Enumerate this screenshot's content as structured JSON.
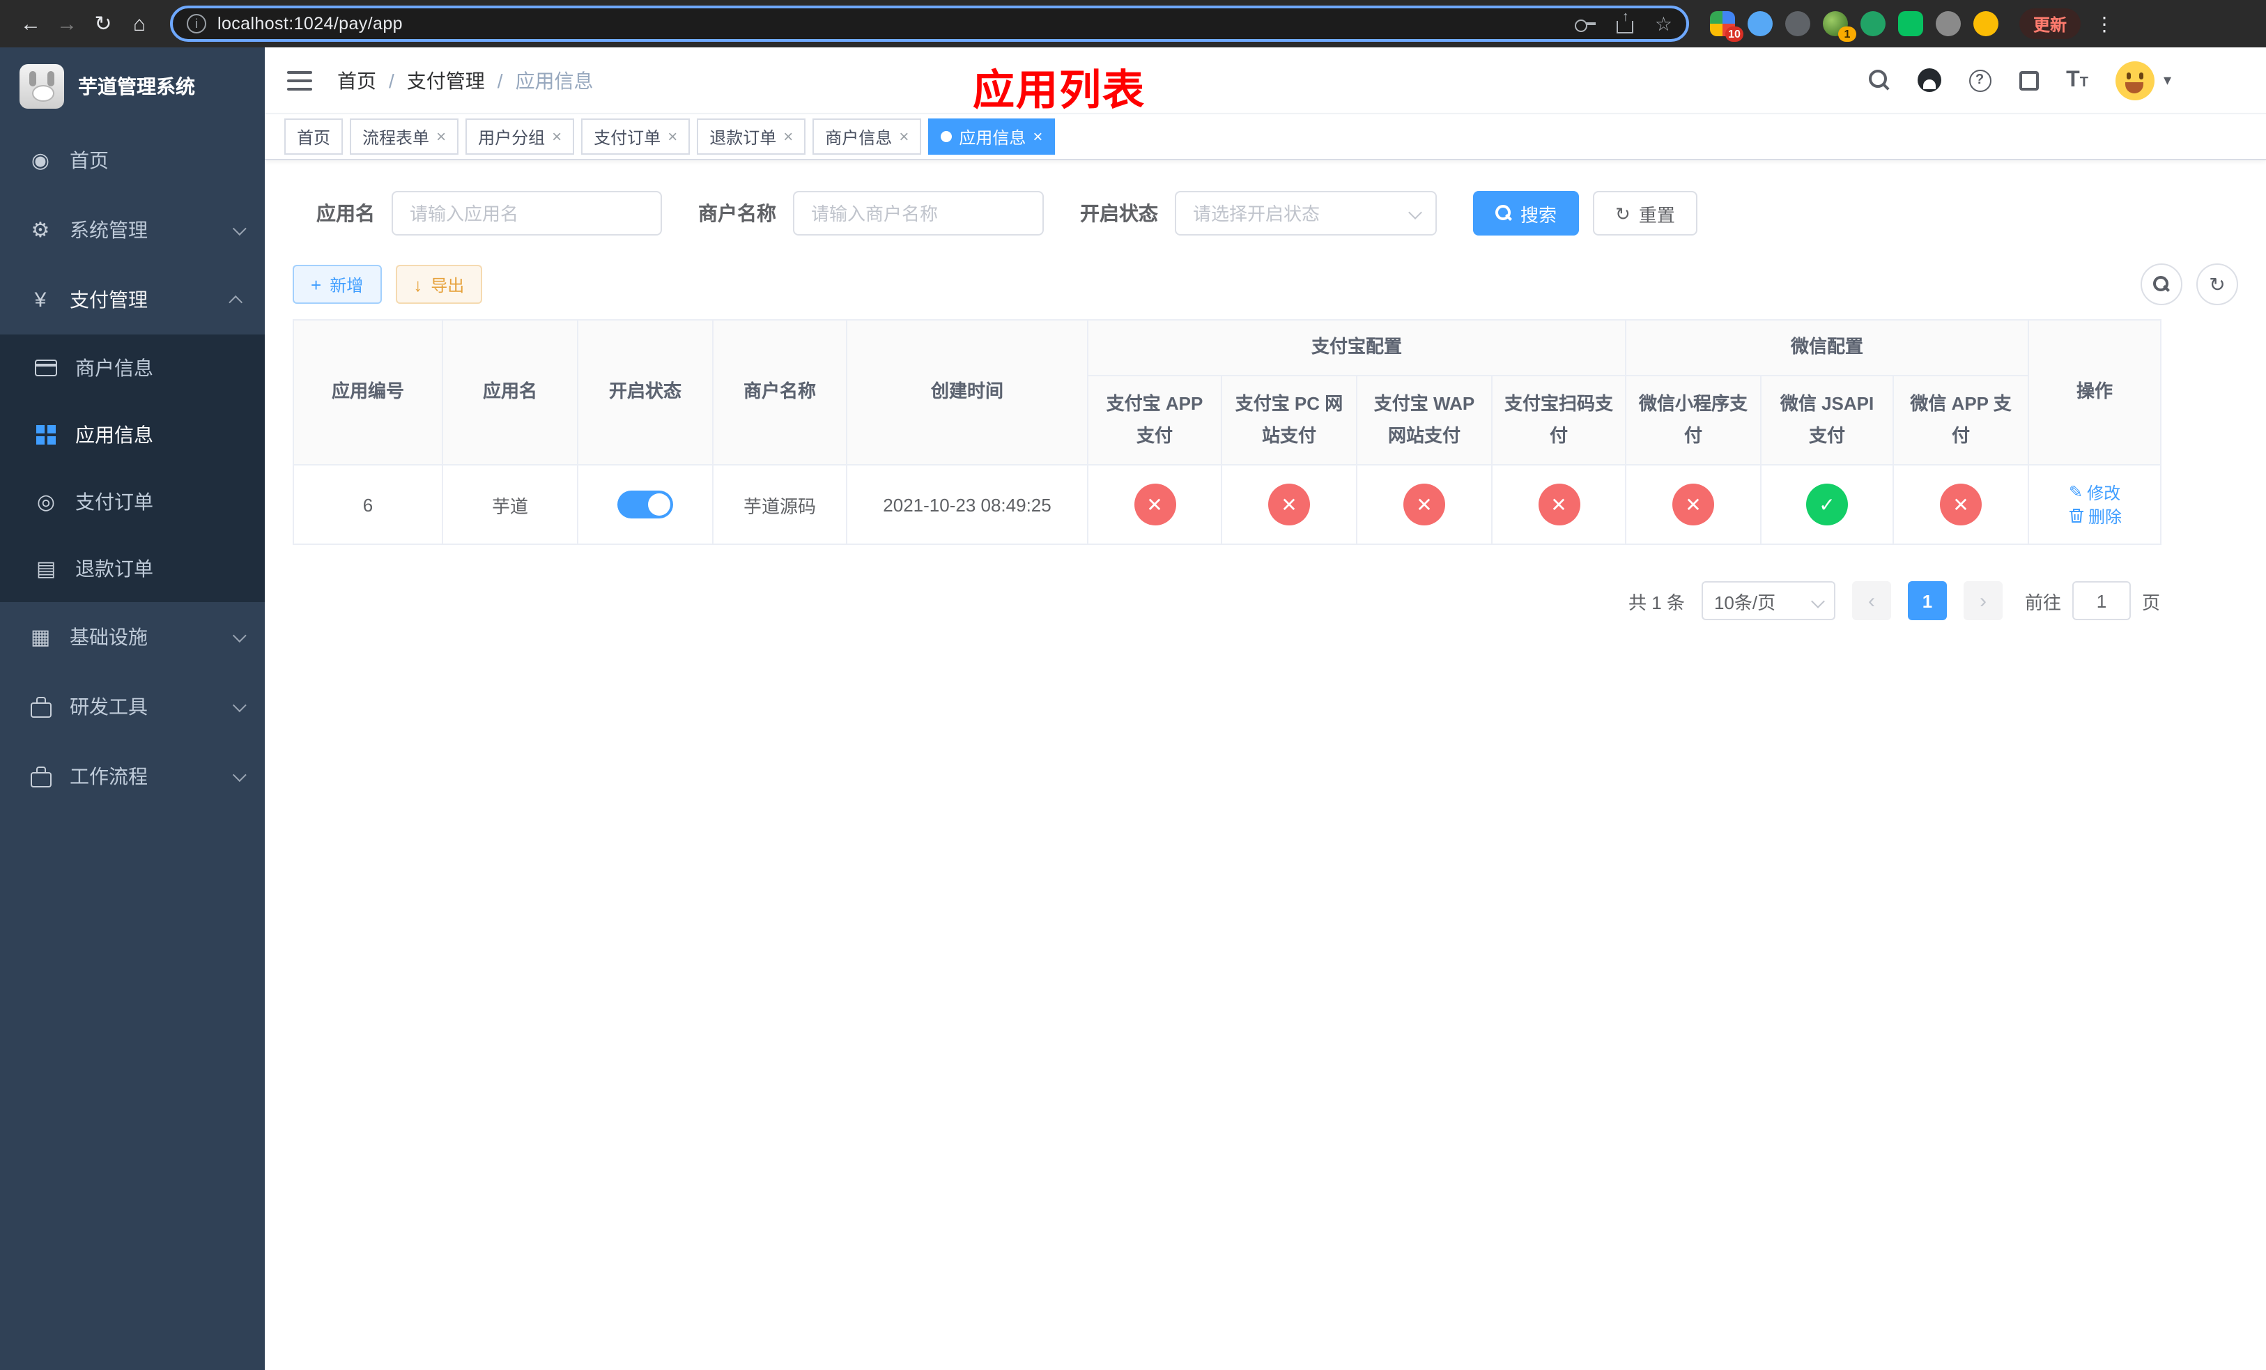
{
  "browser": {
    "url": "localhost:1024/pay/app",
    "update_label": "更新",
    "extension_badge_grid": "10",
    "extension_badge_green": "1"
  },
  "icons": {
    "back_glyph": "←",
    "forward_glyph": "→",
    "reload_glyph": "↻",
    "home_glyph": "⌂",
    "info_glyph": "i",
    "star_glyph": "☆",
    "dots_glyph": "⋮",
    "dashboard_glyph": "◉",
    "gear_glyph": "⚙",
    "yen_glyph": "¥",
    "order_glyph": "◎",
    "refund_glyph": "▤",
    "infra_glyph": "▦",
    "question_glyph": "?",
    "font_glyph": "T",
    "caret_glyph": "▾",
    "close_glyph": "×",
    "plus_glyph": "+",
    "download_glyph": "↓",
    "refresh_glyph": "↻",
    "check_glyph": "✓",
    "cross_glyph": "✕",
    "edit_glyph": "✎",
    "prev_glyph": "‹",
    "next_glyph": "›",
    "slash_glyph": "/"
  },
  "sidebar": {
    "title": "芋道管理系统",
    "home": "首页",
    "system": "系统管理",
    "payment": "支付管理",
    "merchant": "商户信息",
    "app": "应用信息",
    "order": "支付订单",
    "refund": "退款订单",
    "infra": "基础设施",
    "devtools": "研发工具",
    "workflow": "工作流程"
  },
  "navbar": {
    "breadcrumb": [
      "首页",
      "支付管理",
      "应用信息"
    ],
    "annotation": "应用列表"
  },
  "tabs": [
    {
      "label": "首页"
    },
    {
      "label": "流程表单"
    },
    {
      "label": "用户分组"
    },
    {
      "label": "支付订单"
    },
    {
      "label": "退款订单"
    },
    {
      "label": "商户信息"
    },
    {
      "label": "应用信息"
    }
  ],
  "filters": {
    "app_name_label": "应用名",
    "app_name_placeholder": "请输入应用名",
    "merchant_label": "商户名称",
    "merchant_placeholder": "请输入商户名称",
    "status_label": "开启状态",
    "status_placeholder": "请选择开启状态",
    "search_label": "搜索",
    "reset_label": "重置"
  },
  "toolbar": {
    "add_label": "新增",
    "export_label": "导出"
  },
  "table": {
    "headers": {
      "app_id": "应用编号",
      "app_name": "应用名",
      "status": "开启状态",
      "merchant_name": "商户名称",
      "create_time": "创建时间",
      "alipay_group": "支付宝配置",
      "wechat_group": "微信配置",
      "alipay_app": "支付宝 APP 支付",
      "alipay_pc": "支付宝 PC 网站支付",
      "alipay_wap": "支付宝 WAP 网站支付",
      "alipay_qr": "支付宝扫码支付",
      "wechat_lite": "微信小程序支付",
      "wechat_jsapi": "微信 JSAPI 支付",
      "wechat_app": "微信 APP 支付",
      "actions": "操作"
    },
    "rows": [
      {
        "app_id": "6",
        "app_name": "芋道",
        "status_on": true,
        "merchant_name": "芋道源码",
        "create_time": "2021-10-23 08:49:25",
        "cfg": {
          "alipay_app": "disabled",
          "alipay_pc": "disabled",
          "alipay_wap": "disabled",
          "alipay_qr": "disabled",
          "wechat_lite": "disabled",
          "wechat_jsapi": "enabled",
          "wechat_app": "disabled"
        },
        "edit": "修改",
        "delete": "删除"
      }
    ]
  },
  "pagination": {
    "total": "共 1 条",
    "page_size": "10条/页",
    "page": "1",
    "goto": "前往",
    "goto_value": "1",
    "unit": "页"
  },
  "colors": {
    "primary": "#409eff",
    "success": "#13ce66",
    "danger": "#f56c6c",
    "annotation_red": "#ff0000",
    "sidebar_bg": "#304156",
    "sidebar_submenu_bg": "#1f2d3d"
  }
}
